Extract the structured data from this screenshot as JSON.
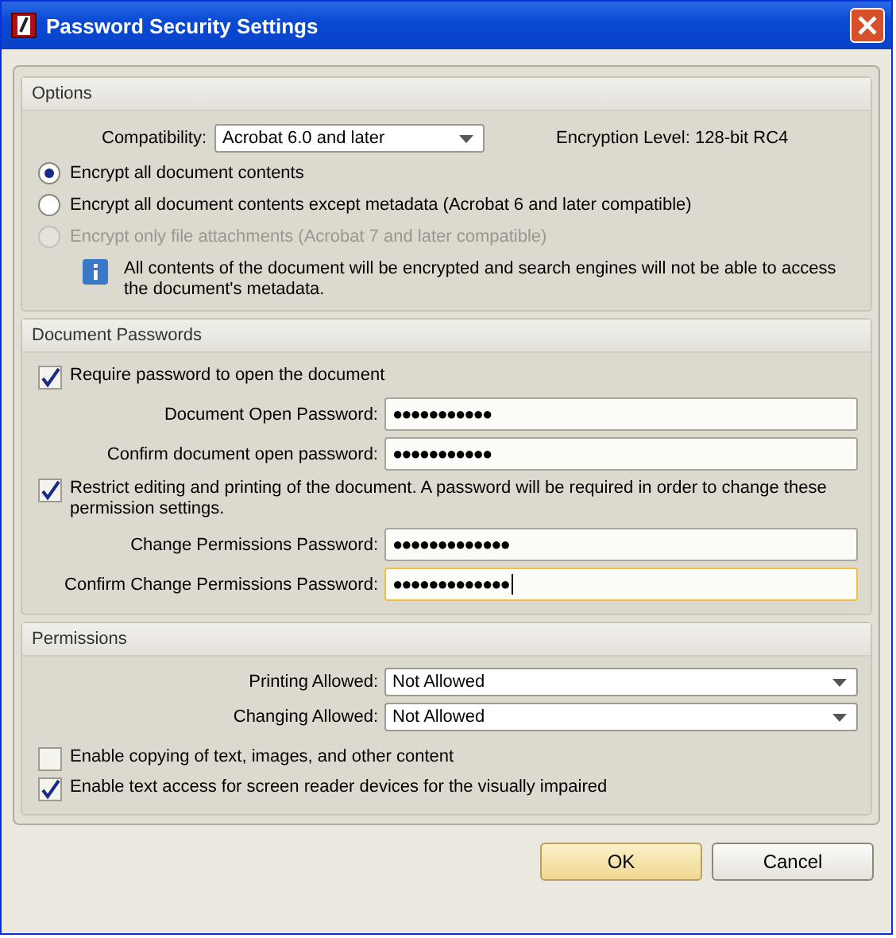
{
  "window": {
    "title": "Password Security Settings"
  },
  "options": {
    "heading": "Options",
    "compatibility": {
      "label": "Compatibility:",
      "value": "Acrobat 6.0 and later"
    },
    "encryption": "Encryption Level: 128-bit RC4",
    "radios": [
      {
        "label": "Encrypt all document contents",
        "selected": true,
        "disabled": false
      },
      {
        "label": "Encrypt all document contents except metadata (Acrobat 6 and later compatible)",
        "selected": false,
        "disabled": false
      },
      {
        "label": "Encrypt only file attachments (Acrobat 7 and later compatible)",
        "selected": false,
        "disabled": true
      }
    ],
    "info": "All contents of the document will be encrypted and search engines will not be able to access the document's metadata."
  },
  "passwords": {
    "heading": "Document Passwords",
    "items": [
      {
        "kind": "checkbox",
        "label": "Require password to open the document",
        "checked": true
      },
      {
        "kind": "field",
        "label": "Document Open Password:",
        "value": "●●●●●●●●●●●",
        "focused": false
      },
      {
        "kind": "field",
        "label": "Confirm document open password:",
        "value": "●●●●●●●●●●●",
        "focused": false
      },
      {
        "kind": "checkbox",
        "label": "Restrict editing and printing of the document. A password will be required in order to change these permission settings.",
        "checked": true
      },
      {
        "kind": "field",
        "label": "Change Permissions Password:",
        "value": "●●●●●●●●●●●●●",
        "focused": false
      },
      {
        "kind": "field",
        "label": "Confirm Change Permissions Password:",
        "value": "●●●●●●●●●●●●●",
        "focused": true
      }
    ]
  },
  "permissions": {
    "heading": "Permissions",
    "dropdowns": [
      {
        "label": "Printing Allowed:",
        "value": "Not Allowed"
      },
      {
        "label": "Changing Allowed:",
        "value": "Not Allowed"
      }
    ],
    "checkboxes": [
      {
        "label": "Enable copying of text, images, and other content",
        "checked": false
      },
      {
        "label": "Enable text access for screen reader devices for the visually impaired",
        "checked": true
      }
    ]
  },
  "buttons": [
    {
      "label": "OK",
      "default": true
    },
    {
      "label": "Cancel",
      "default": false
    }
  ]
}
